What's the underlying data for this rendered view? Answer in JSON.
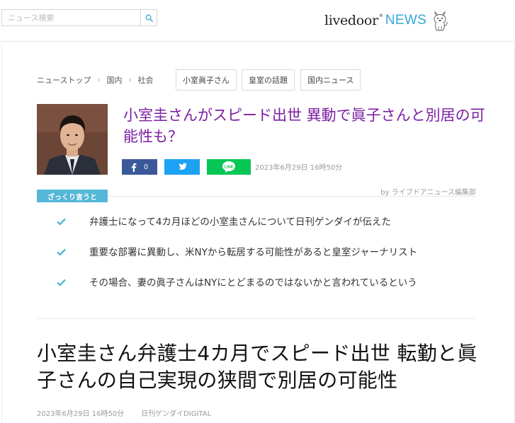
{
  "search": {
    "placeholder": "ニュース検索"
  },
  "logo": {
    "brand": "livedoor",
    "reg": "®",
    "news": "NEWS"
  },
  "breadcrumbs": [
    "ニューストップ",
    "国内",
    "社会"
  ],
  "tags": [
    "小室眞子さん",
    "皇室の話題",
    "国内ニュース"
  ],
  "article": {
    "title": "小室圭さんがスピード出世 異動で眞子さんと別居の可能性も？",
    "facebook_count": "0",
    "date": "2023年6月29日 16時50分",
    "byline": "by ライブドアニュース編集部",
    "summary_label": "ざっくり言うと",
    "points": [
      "弁護士になって4カ月ほどの小室圭さんについて日刊ゲンダイが伝えた",
      "重要な部署に異動し、米NYから転居する可能性があると皇室ジャーナリスト",
      "その場合、妻の眞子さんはNYにとどまるのではないかと言われているという"
    ]
  },
  "source_article": {
    "headline": "小室圭さん弁護士4カ月でスピード出世 転勤と眞子さんの自己実現の狭間で別居の可能性",
    "date": "2023年6月29日 16時50分",
    "source": "日刊ゲンダイDIGITAL"
  },
  "colors": {
    "title": "#7b1fa2",
    "accent": "#55b7d8",
    "facebook": "#3b5998",
    "twitter": "#1da1f2",
    "line": "#06c755"
  }
}
